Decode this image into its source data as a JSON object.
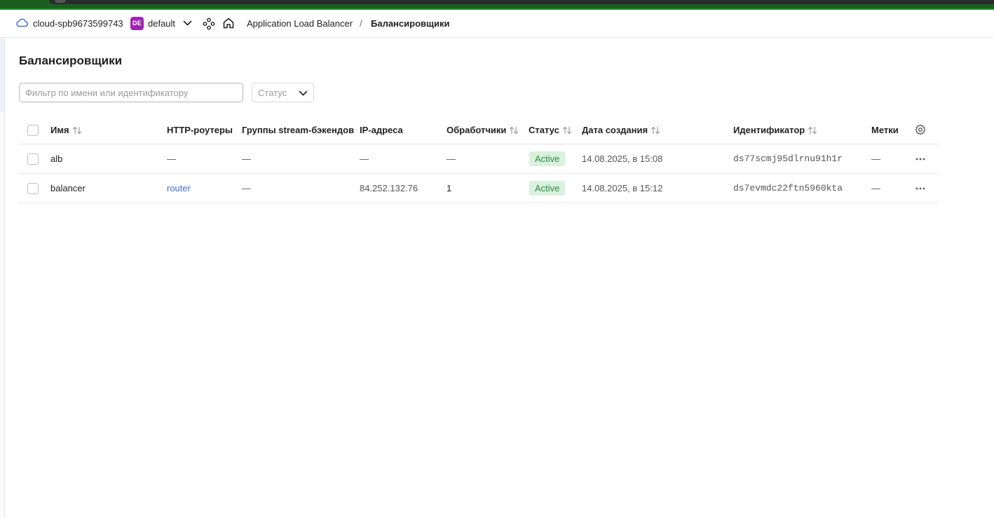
{
  "header": {
    "cloud_name": "cloud-spb9673599743",
    "folder_badge": "DE",
    "folder_name": "default",
    "breadcrumb_service": "Application Load Balancer",
    "breadcrumb_separator": "/",
    "breadcrumb_current": "Балансировщики"
  },
  "page": {
    "title": "Балансировщики"
  },
  "filters": {
    "search_placeholder": "Фильтр по имени или идентификатору",
    "search_value": "",
    "status_placeholder": "Статус"
  },
  "table": {
    "columns": {
      "name": "Имя",
      "http_routers": "HTTP-роутеры",
      "stream_groups": "Группы stream-бэкендов",
      "ip": "IP-адреса",
      "listeners": "Обработчики",
      "status": "Статус",
      "created": "Дата создания",
      "id": "Идентификатор",
      "labels": "Метки"
    },
    "rows": [
      {
        "name": "alb",
        "http_routers": "—",
        "stream_groups": "—",
        "ip": "—",
        "listeners": "—",
        "status": "Active",
        "created": "14.08.2025, в 15:08",
        "id": "ds77scmj95dlrnu91h1r",
        "labels": "—"
      },
      {
        "name": "balancer",
        "http_routers": "router",
        "stream_groups": "—",
        "ip": "84.252.132.76",
        "listeners": "1",
        "status": "Active",
        "created": "14.08.2025, в 15:12",
        "id": "ds7evmdc22ftn5960kta",
        "labels": "—"
      }
    ]
  },
  "colors": {
    "accent_link": "#3e6fd8",
    "status_active_bg": "#d9f1dd",
    "status_active_text": "#2e8b3e",
    "folder_badge": "#9c27b0"
  },
  "icons": [
    "cloud-icon",
    "chevron-down-icon",
    "services-icon",
    "home-icon",
    "sort-icon",
    "gear-icon",
    "more-icon"
  ]
}
